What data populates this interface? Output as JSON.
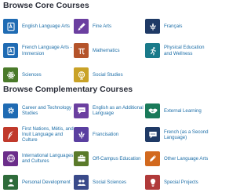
{
  "core": {
    "title": "Browse Core Courses",
    "courses": [
      {
        "label": "English Language Arts",
        "icon": "book-letter-icon",
        "color": "#1f6bb3"
      },
      {
        "label": "Fine Arts",
        "icon": "paintbrush-icon",
        "color": "#6b3fa0"
      },
      {
        "label": "Français",
        "icon": "fleur-de-lis-icon",
        "color": "#1f3a66"
      },
      {
        "label": "French Language Arts - Immersion",
        "icon": "book-letter-icon",
        "color": "#1f6bb3"
      },
      {
        "label": "Mathematics",
        "icon": "pi-icon",
        "color": "#b4532a"
      },
      {
        "label": "Physical Education and Wellness",
        "icon": "runner-icon",
        "color": "#1a7a8a"
      },
      {
        "label": "Sciences",
        "icon": "atom-icon",
        "color": "#4a7a2a"
      },
      {
        "label": "Social Studies",
        "icon": "globe-icon",
        "color": "#c9a227"
      }
    ]
  },
  "complementary": {
    "title": "Browse Complementary Courses",
    "courses": [
      {
        "label": "Career and Technology Studies",
        "icon": "gear-icon",
        "color": "#1f6bb3"
      },
      {
        "label": "English as an Additional Language",
        "icon": "speech-bubble-icon",
        "color": "#6b3fa0"
      },
      {
        "label": "External Learning",
        "icon": "handshake-icon",
        "color": "#1a7a5a"
      },
      {
        "label": "First Nations, Métis, and Inuit Language and Culture",
        "icon": "feather-icon",
        "color": "#c0392b"
      },
      {
        "label": "Francisation",
        "icon": "fleur-de-lis-icon",
        "color": "#5a3fa0"
      },
      {
        "label": "French (as a Second Language)",
        "icon": "speech-bubble-icon",
        "color": "#1f3a66"
      },
      {
        "label": "International Languages and Cultures",
        "icon": "world-icon",
        "color": "#6b2d8a"
      },
      {
        "label": "Off-Campus Education",
        "icon": "briefcase-icon",
        "color": "#5a7a2a"
      },
      {
        "label": "Other Language Arts",
        "icon": "pencil-icon",
        "color": "#d2691e"
      },
      {
        "label": "Personal Development",
        "icon": "person-icon",
        "color": "#2e6b3a"
      },
      {
        "label": "Social Sciences",
        "icon": "people-icon",
        "color": "#3a4a8a"
      },
      {
        "label": "Special Projects",
        "icon": "lightbulb-icon",
        "color": "#b03a3a"
      }
    ]
  }
}
